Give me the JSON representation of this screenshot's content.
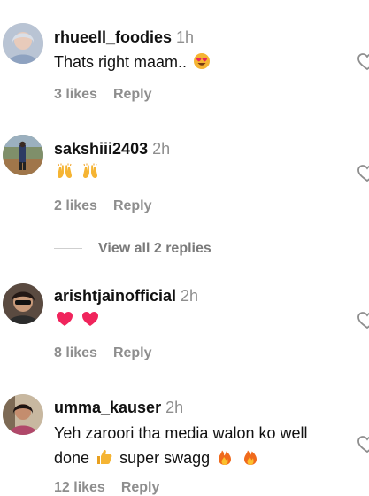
{
  "comments": [
    {
      "username": "rhueell_foodies",
      "time": "1h",
      "text": "Thats right maam..",
      "emojis": [
        "heart-eyes"
      ],
      "likes": "3 likes",
      "reply": "Reply"
    },
    {
      "username": "sakshiii2403",
      "time": "2h",
      "text": "",
      "emojis": [
        "raised-hands",
        "raised-hands"
      ],
      "likes": "2 likes",
      "reply": "Reply",
      "view_replies": "View all 2 replies"
    },
    {
      "username": "arishtjainofficial",
      "time": "2h",
      "text": "",
      "emojis": [
        "red-heart",
        "red-heart"
      ],
      "likes": "8 likes",
      "reply": "Reply"
    },
    {
      "username": "umma_kauser",
      "time": "2h",
      "text_line1": "Yeh zaroori tha media walon ko well",
      "text_line2_a": "done",
      "text_line2_b": "super swagg",
      "emojis": [
        "thumbs-up",
        "fire",
        "fire"
      ],
      "likes": "12 likes",
      "reply": "Reply"
    }
  ],
  "colors": {
    "text": "#111111",
    "muted": "#8e8e8e",
    "heart": "#e8245c"
  }
}
